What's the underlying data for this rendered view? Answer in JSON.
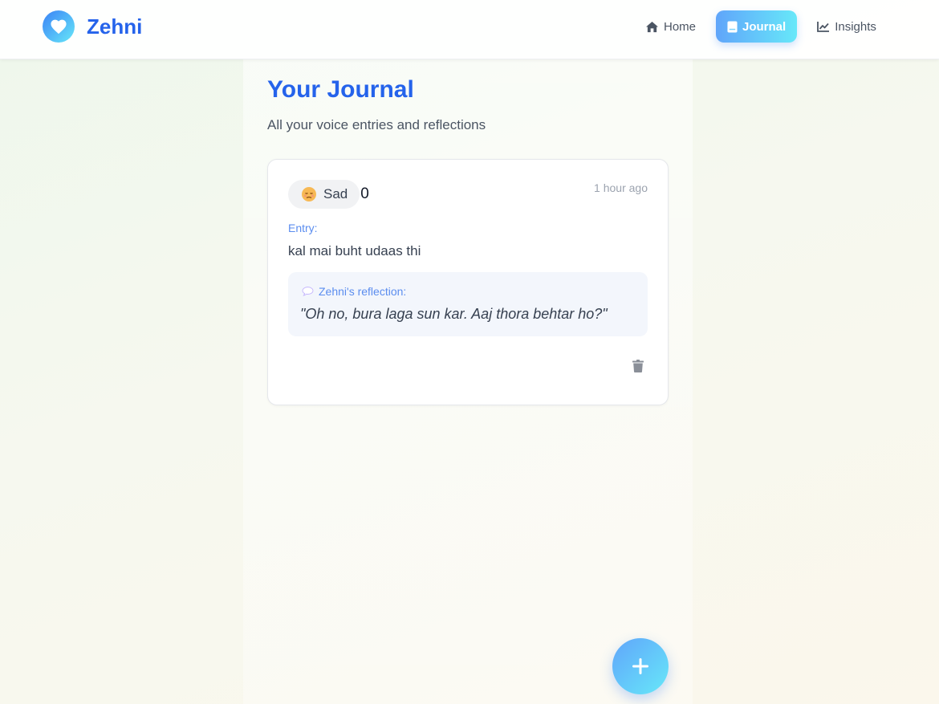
{
  "app": {
    "name": "Zehni"
  },
  "nav": {
    "items": [
      {
        "label": "Home",
        "icon": "home-icon",
        "active": false
      },
      {
        "label": "Journal",
        "icon": "journal-icon",
        "active": true
      },
      {
        "label": "Insights",
        "icon": "chart-line-icon",
        "active": false
      }
    ]
  },
  "page": {
    "title": "Your Journal",
    "subtitle": "All your voice entries and reflections"
  },
  "entries": [
    {
      "mood": "Sad",
      "mood_icon": "sad-face-icon",
      "count": "0",
      "time": "1 hour ago",
      "entry_label": "Entry:",
      "text": "kal mai buht udaas thi",
      "reflection_label": "Zehni's reflection:",
      "reflection_icon": "speech-bubble-icon",
      "reflection": "\"Oh no, bura laga sun kar. Aaj thora behtar ho?\"",
      "delete_icon": "trash-icon"
    }
  ],
  "fab": {
    "icon": "plus-icon"
  },
  "colors": {
    "brand": "#2563eb",
    "accent_gradient_start": "#60a5fa",
    "accent_gradient_end": "#67e8f9",
    "label_blue": "#5b8def"
  }
}
